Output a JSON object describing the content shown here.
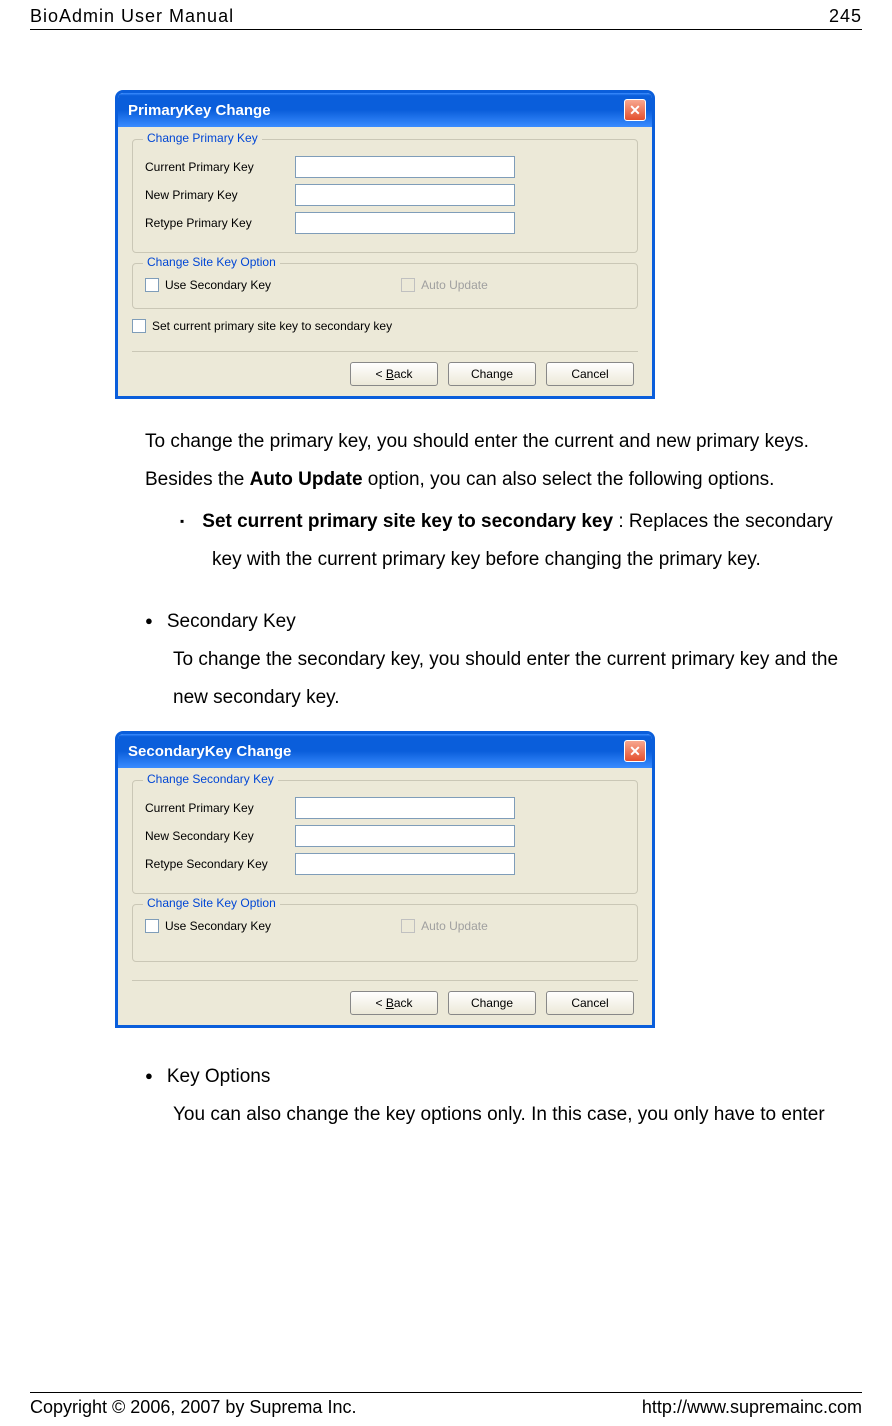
{
  "header": {
    "title": "BioAdmin User Manual",
    "page_num": "245"
  },
  "dialog1": {
    "title": "PrimaryKey Change",
    "group1_legend": "Change Primary Key",
    "label_current": "Current Primary Key",
    "label_new": "New Primary Key",
    "label_retype": "Retype Primary Key",
    "group2_legend": "Change Site Key Option",
    "opt_secondary": "Use Secondary Key",
    "opt_auto": "Auto Update",
    "opt_set_secondary": "Set current primary site key to secondary key",
    "btn_back_pre": "< ",
    "btn_back_u": "B",
    "btn_back_post": "ack",
    "btn_change": "Change",
    "btn_cancel": "Cancel"
  },
  "para1_a": "To change the primary key, you should enter the current and new primary keys. Besides the ",
  "para1_bold": "Auto Update",
  "para1_b": " option, you can also select the following options.",
  "bullet1_bold": "Set current primary site key to secondary key",
  "bullet1_rest": " : Replaces the secondary key with the current primary key before changing the primary key.",
  "sk_heading": "Secondary Key",
  "para2": "To change the secondary key, you should enter the current primary key and the new secondary key.",
  "dialog2": {
    "title": "SecondaryKey Change",
    "group1_legend": "Change Secondary Key",
    "label_current": "Current Primary Key",
    "label_new": "New Secondary Key",
    "label_retype": "Retype Secondary Key",
    "group2_legend": "Change Site Key Option",
    "opt_secondary": "Use Secondary Key",
    "opt_auto": "Auto Update",
    "btn_back_pre": "< ",
    "btn_back_u": "B",
    "btn_back_post": "ack",
    "btn_change": "Change",
    "btn_cancel": "Cancel"
  },
  "ko_heading": "Key Options",
  "para3": "You can also change the key options only. In this case, you only have to enter",
  "footer": {
    "copyright": "Copyright © 2006, 2007 by Suprema Inc.",
    "url": "http://www.supremainc.com"
  }
}
